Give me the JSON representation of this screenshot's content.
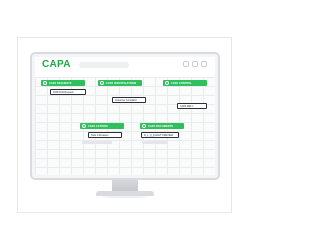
{
  "app": {
    "logo": "CAPA"
  },
  "colors": {
    "accent": "#2fbf5c",
    "logo": "#1fa84a"
  },
  "cards": [
    {
      "title": "CAPA REQUESTS",
      "icon": "alert-icon"
    },
    {
      "title": "CAPA INVESTIGATIONS",
      "icon": "phone-icon"
    },
    {
      "title": "CAPA CONTROL",
      "icon": "gear-icon"
    },
    {
      "title": "CAPA ACTIONS",
      "icon": "check-icon"
    },
    {
      "title": "CAPA DOCUMENTS",
      "icon": "document-icon"
    }
  ],
  "fields": [
    {
      "text": "NCR/COA Request"
    },
    {
      "text": "Customer Complaint"
    },
    {
      "text": "CAPA REF 1"
    },
    {
      "text": "Task 1 Reviewer"
    },
    {
      "text": "R_1_Q_QUALITY/REVIEW"
    }
  ]
}
